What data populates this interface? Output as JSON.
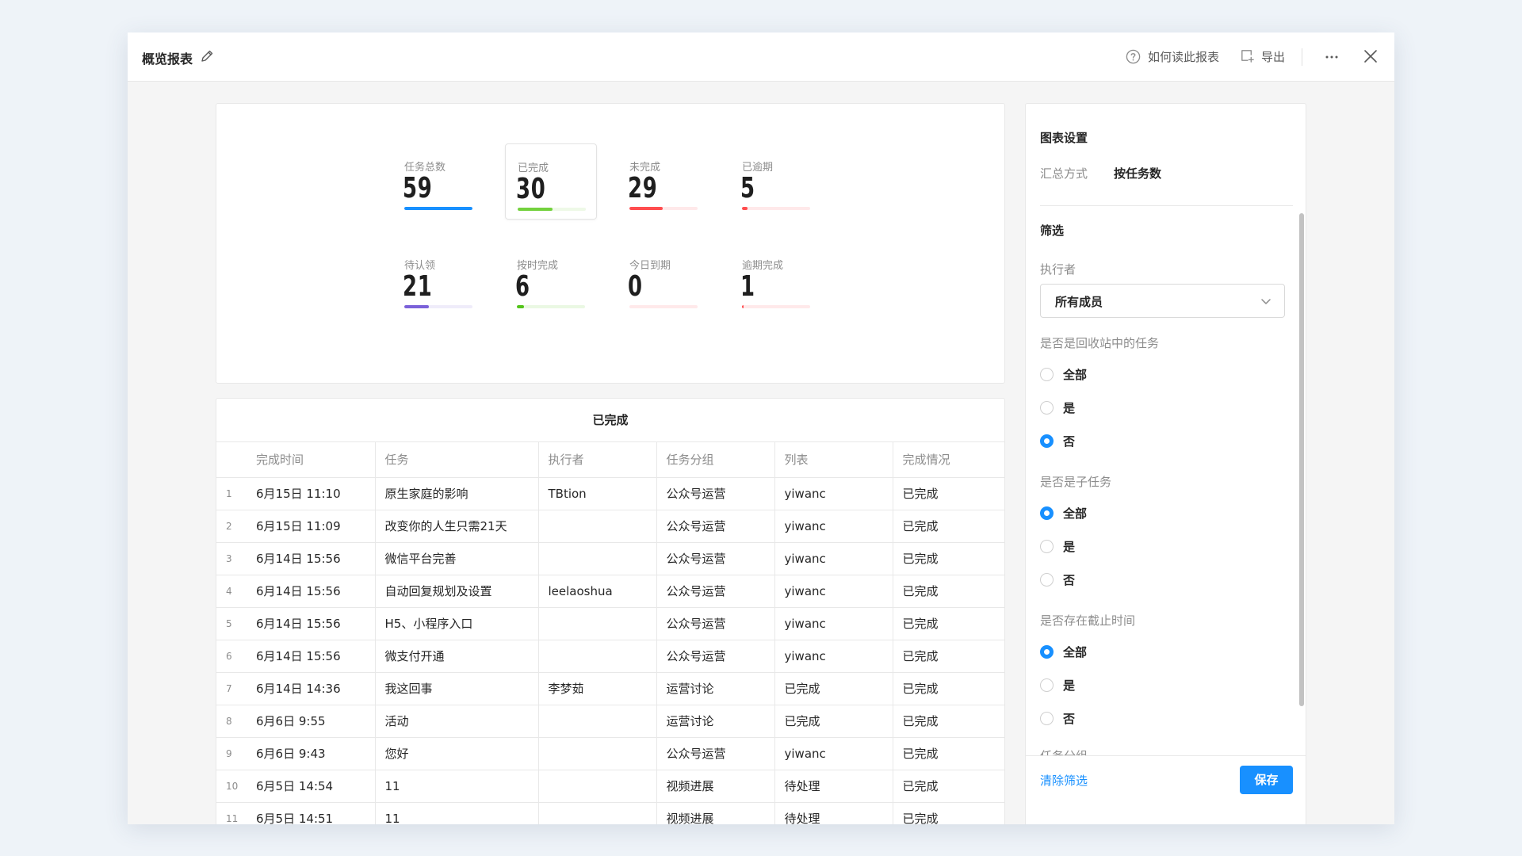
{
  "header": {
    "title": "概览报表",
    "help_label": "如何读此报表",
    "export_label": "导出"
  },
  "stats": [
    {
      "label": "任务总数",
      "value": "59",
      "fill": 1.0,
      "color": "#1890ff"
    },
    {
      "label": "已完成",
      "value": "30",
      "fill": 0.51,
      "color": "#73d13d"
    },
    {
      "label": "未完成",
      "value": "29",
      "fill": 0.49,
      "color": "#ff4d4f"
    },
    {
      "label": "已逾期",
      "value": "5",
      "fill": 0.08,
      "color": "#ff4d4f"
    },
    {
      "label": "待认领",
      "value": "21",
      "fill": 0.36,
      "color": "#7b61d9"
    },
    {
      "label": "按时完成",
      "value": "6",
      "fill": 0.1,
      "color": "#52c41a"
    },
    {
      "label": "今日到期",
      "value": "0",
      "fill": 0.0,
      "color": "#ff4d4f"
    },
    {
      "label": "逾期完成",
      "value": "1",
      "fill": 0.02,
      "color": "#ff4d4f"
    }
  ],
  "table": {
    "title": "已完成",
    "columns": [
      "完成时间",
      "任务",
      "执行者",
      "任务分组",
      "列表",
      "完成情况"
    ],
    "rows": [
      [
        "1",
        "6月15日 11:10",
        "原生家庭的影响",
        "TBtion",
        "公众号运营",
        "yiwanc",
        "已完成"
      ],
      [
        "2",
        "6月15日 11:09",
        "改变你的人生只需21天",
        "",
        "公众号运营",
        "yiwanc",
        "已完成"
      ],
      [
        "3",
        "6月14日 15:56",
        "微信平台完善",
        "",
        "公众号运营",
        "yiwanc",
        "已完成"
      ],
      [
        "4",
        "6月14日 15:56",
        "自动回复规划及设置",
        "leelaoshua",
        "公众号运营",
        "yiwanc",
        "已完成"
      ],
      [
        "5",
        "6月14日 15:56",
        "H5、小程序入口",
        "",
        "公众号运营",
        "yiwanc",
        "已完成"
      ],
      [
        "6",
        "6月14日 15:56",
        "微支付开通",
        "",
        "公众号运营",
        "yiwanc",
        "已完成"
      ],
      [
        "7",
        "6月14日 14:36",
        "我这回事",
        "李梦茹",
        "运营讨论",
        "已完成",
        "已完成"
      ],
      [
        "8",
        "6月6日 9:55",
        "活动",
        "",
        "运营讨论",
        "已完成",
        "已完成"
      ],
      [
        "9",
        "6月6日 9:43",
        "您好",
        "",
        "公众号运营",
        "yiwanc",
        "已完成"
      ],
      [
        "10",
        "6月5日 14:54",
        "11",
        "",
        "视频进展",
        "待处理",
        "已完成"
      ],
      [
        "11",
        "6月5日 14:51",
        "11",
        "",
        "视频进展",
        "待处理",
        "已完成"
      ]
    ]
  },
  "settings": {
    "chart_heading": "图表设置",
    "summary_label": "汇总方式",
    "summary_value": "按任务数",
    "filter_heading": "筛选",
    "assignee_label": "执行者",
    "assignee_value": "所有成员",
    "groups": [
      {
        "label": "是否是回收站中的任务",
        "options": [
          "全部",
          "是",
          "否"
        ],
        "selected": 2
      },
      {
        "label": "是否是子任务",
        "options": [
          "全部",
          "是",
          "否"
        ],
        "selected": 0
      },
      {
        "label": "是否存在截止时间",
        "options": [
          "全部",
          "是",
          "否"
        ],
        "selected": 0
      }
    ],
    "next_group_label": "任务分组",
    "clear_label": "清除筛选",
    "save_label": "保存"
  },
  "colors": {
    "accent": "#1890ff",
    "bar_track": "#f0f0f0"
  }
}
